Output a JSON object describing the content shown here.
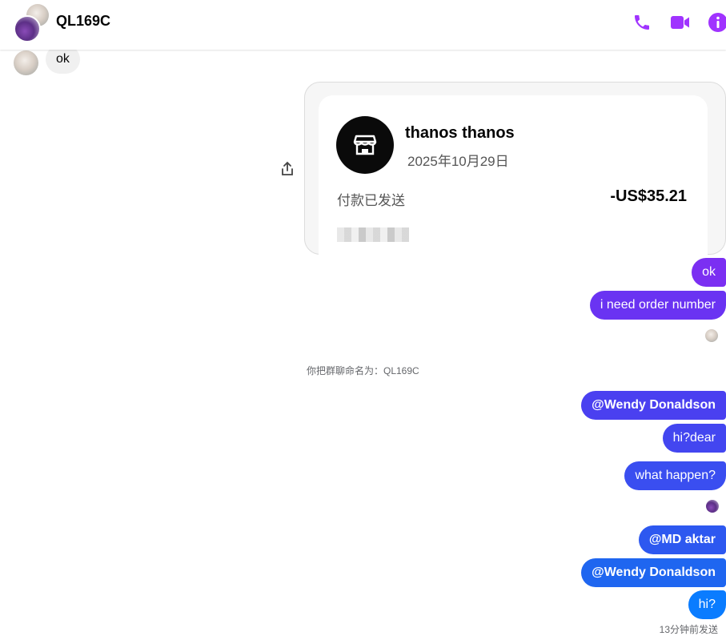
{
  "header": {
    "title": "QL169C",
    "icons": [
      "phone-icon",
      "video-icon",
      "info-icon"
    ],
    "accent": "#a033ff"
  },
  "messages": {
    "incoming_ok": "ok",
    "payment": {
      "name": "thanos thanos",
      "date": "2025年10月29日",
      "status": "付款已发送",
      "amount": "-US$35.21"
    },
    "out1": "ok",
    "out2": "i need order number",
    "system": "你把群聊命名为：QL169C",
    "out3": "@Wendy Donaldson",
    "out4": "hi?dear",
    "out5": "what happen?",
    "out6": "@MD aktar",
    "out7": "@Wendy Donaldson",
    "out8": "hi?",
    "sent_time": "13分钟前发送"
  },
  "colors": {
    "bubble_purple": "#7b2ff2",
    "bubble_indigo": "#5b3cf0",
    "bubble_blue": "#3a4ef0",
    "bubble_blue2": "#2562f0",
    "bubble_blue3": "#0a7cff",
    "incoming_bg": "#f0f0f0"
  }
}
